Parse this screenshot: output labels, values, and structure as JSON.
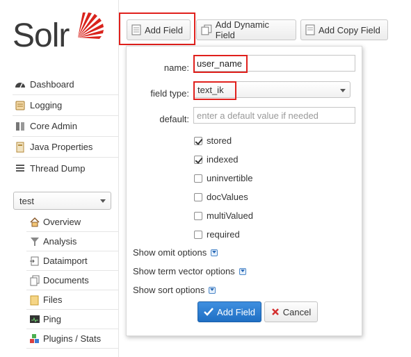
{
  "app": {
    "logo_text": "Solr"
  },
  "sidebar": {
    "items": [
      {
        "label": "Dashboard",
        "icon": "dashboard-icon"
      },
      {
        "label": "Logging",
        "icon": "logging-icon"
      },
      {
        "label": "Core Admin",
        "icon": "core-admin-icon"
      },
      {
        "label": "Java Properties",
        "icon": "java-properties-icon"
      },
      {
        "label": "Thread Dump",
        "icon": "thread-dump-icon"
      }
    ],
    "core_selector": {
      "selected": "test"
    },
    "core_items": [
      {
        "label": "Overview",
        "icon": "home-icon"
      },
      {
        "label": "Analysis",
        "icon": "funnel-icon"
      },
      {
        "label": "Dataimport",
        "icon": "dataimport-icon"
      },
      {
        "label": "Documents",
        "icon": "documents-icon"
      },
      {
        "label": "Files",
        "icon": "folder-icon"
      },
      {
        "label": "Ping",
        "icon": "ping-icon"
      },
      {
        "label": "Plugins / Stats",
        "icon": "plugins-icon"
      }
    ]
  },
  "toolbar": {
    "add_field": "Add Field",
    "add_dynamic_field": "Add Dynamic Field",
    "add_copy_field": "Add Copy Field"
  },
  "form": {
    "name_label": "name:",
    "name_value": "user_name",
    "field_type_label": "field type:",
    "field_type_value": "text_ik",
    "default_label": "default:",
    "default_placeholder": "enter a default value if needed",
    "checkboxes": [
      {
        "label": "stored",
        "checked": true
      },
      {
        "label": "indexed",
        "checked": true
      },
      {
        "label": "uninvertible",
        "checked": false
      },
      {
        "label": "docValues",
        "checked": false
      },
      {
        "label": "multiValued",
        "checked": false
      },
      {
        "label": "required",
        "checked": false
      }
    ],
    "options": [
      {
        "label": "Show omit options"
      },
      {
        "label": "Show term vector options"
      },
      {
        "label": "Show sort options"
      }
    ],
    "submit_label": "Add Field",
    "cancel_label": "Cancel"
  },
  "colors": {
    "highlight": "#e0201c",
    "primary_button": "#2a7fd4",
    "logo_sun": "#d9231c"
  }
}
